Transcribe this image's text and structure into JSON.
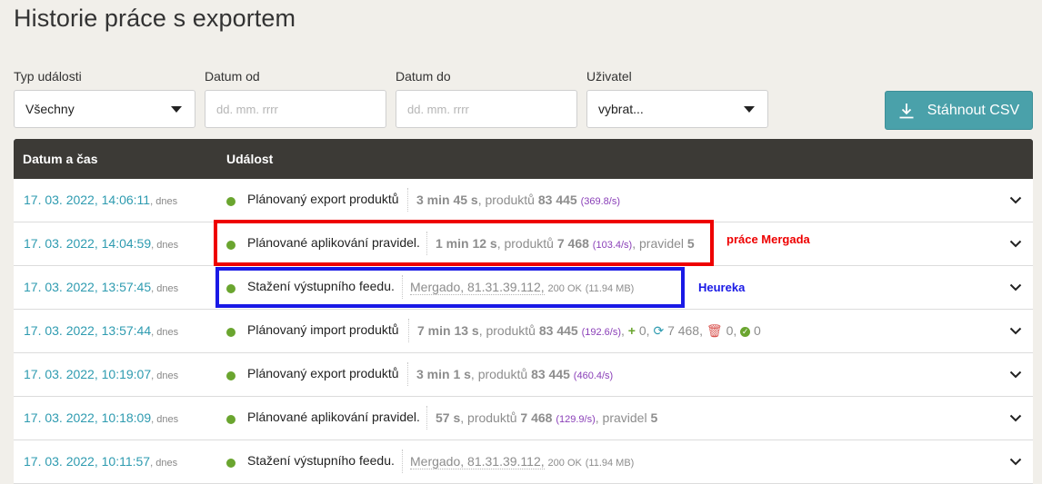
{
  "page": {
    "title": "Historie práce s exportem"
  },
  "filters": {
    "event_type": {
      "label": "Typ události",
      "value": "Všechny"
    },
    "date_from": {
      "label": "Datum od",
      "placeholder": "dd. mm. rrrr"
    },
    "date_to": {
      "label": "Datum do",
      "placeholder": "dd. mm. rrrr"
    },
    "user": {
      "label": "Uživatel",
      "value": "vybrat..."
    }
  },
  "csv_button": {
    "label": "Stáhnout CSV",
    "icon": "download-icon"
  },
  "table": {
    "headers": [
      "Datum a čas",
      "Událost"
    ],
    "rows": [
      {
        "date": "17. 03. 2022, 14:06:11",
        "today": "dnes",
        "event": "Plánovaný export produktů",
        "duration": "3 min 45 s",
        "products_label": "produktů",
        "products": "83 445",
        "rate": "(369.8/s)"
      },
      {
        "date": "17. 03. 2022, 14:04:59",
        "today": "dnes",
        "event": "Plánované aplikování pravidel.",
        "duration": "1 min 12 s",
        "products_label": "produktů",
        "products": "7 468",
        "rate": "(103.4/s)",
        "rules_label": "pravidel",
        "rules": "5"
      },
      {
        "date": "17. 03. 2022, 13:57:45",
        "today": "dnes",
        "event": "Stažení výstupního feedu.",
        "source": "Mergado, 81.31.39.112,",
        "status": "200 OK",
        "size": "(11.94 MB)"
      },
      {
        "date": "17. 03. 2022, 13:57:44",
        "today": "dnes",
        "event": "Plánovaný import produktů",
        "duration": "7 min 13 s",
        "products_label": "produktů",
        "products": "83 445",
        "rate": "(192.6/s)",
        "added": "0",
        "updated": "7 468",
        "deleted": "0",
        "ok": "0"
      },
      {
        "date": "17. 03. 2022, 10:19:07",
        "today": "dnes",
        "event": "Plánovaný export produktů",
        "duration": "3 min 1 s",
        "products_label": "produktů",
        "products": "83 445",
        "rate": "(460.4/s)"
      },
      {
        "date": "17. 03. 2022, 10:18:09",
        "today": "dnes",
        "event": "Plánované aplikování pravidel.",
        "duration": "57 s",
        "products_label": "produktů",
        "products": "7 468",
        "rate": "(129.9/s)",
        "rules_label": "pravidel",
        "rules": "5"
      },
      {
        "date": "17. 03. 2022, 10:11:57",
        "today": "dnes",
        "event": "Stažení výstupního feedu.",
        "source": "Mergado, 81.31.39.112,",
        "status": "200 OK",
        "size": "(11.94 MB)"
      }
    ]
  },
  "annotations": {
    "red": {
      "label": "práce Mergada",
      "color": "#ee0000"
    },
    "blue": {
      "label": "Heureka",
      "color": "#1a1ae6"
    }
  },
  "colors": {
    "accent": "#4aa1aa",
    "header_bg": "#3c3a36",
    "link": "#2e9bb0",
    "status_dot": "#6aa52f",
    "rate": "#8a3fb8"
  }
}
